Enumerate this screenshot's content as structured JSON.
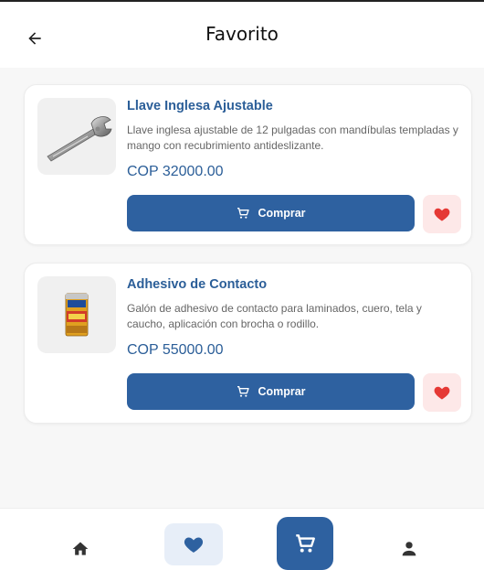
{
  "header": {
    "title": "Favorito",
    "back_icon": "arrow-left-icon"
  },
  "favorites": [
    {
      "name": "Llave Inglesa Ajustable",
      "description": "Llave inglesa ajustable de 12 pulgadas con mandíbulas templadas y mango con recubrimiento antideslizante.",
      "price": "COP 32000.00",
      "buy_label": "Comprar",
      "image_icon": "wrench-icon"
    },
    {
      "name": "Adhesivo de Contacto",
      "description": "Galón de adhesivo de contacto para laminados, cuero, tela y caucho, aplicación con brocha o rodillo.",
      "price": "COP 55000.00",
      "buy_label": "Comprar",
      "image_icon": "adhesive-can-icon"
    }
  ],
  "bottom_nav": [
    {
      "icon": "home-icon",
      "active": false
    },
    {
      "icon": "heart-icon",
      "active": true
    },
    {
      "icon": "cart-icon",
      "active": false
    },
    {
      "icon": "person-icon",
      "active": false
    }
  ],
  "colors": {
    "primary": "#2e61a0",
    "price_text": "#2b5e98",
    "favorite_heart": "#e53935",
    "favorite_bg": "#fde8e8",
    "nav_active_bg": "#e7eef8"
  }
}
